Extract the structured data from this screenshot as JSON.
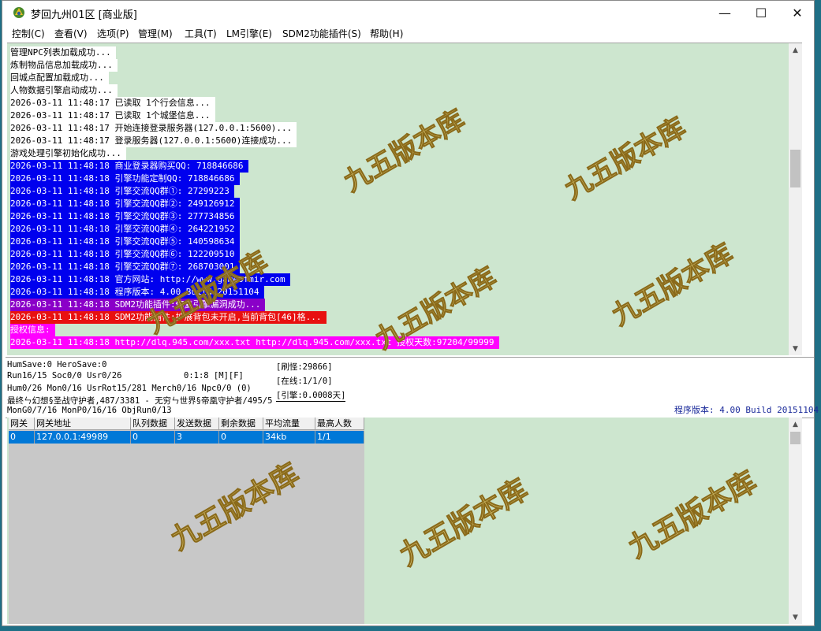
{
  "window": {
    "title": "梦回九州01区 [商业版]",
    "controls": {
      "minimize": "—",
      "maximize": "☐",
      "close": "✕"
    }
  },
  "menu": [
    {
      "label": "控制(C)"
    },
    {
      "label": "查看(V)"
    },
    {
      "label": "选项(P)"
    },
    {
      "label": "管理(M)"
    },
    {
      "label": "工具(T)"
    },
    {
      "label": "LM引擎(E)"
    },
    {
      "label": "SDM2功能插件(S)"
    },
    {
      "label": "帮助(H)"
    }
  ],
  "log": {
    "lines": [
      {
        "text": "管理NPC列表加载成功...",
        "bg": "#ffffff",
        "fg": "#000000"
      },
      {
        "text": "炼制物品信息加载成功...",
        "bg": "#ffffff",
        "fg": "#000000"
      },
      {
        "text": "回城点配置加载成功...",
        "bg": "#ffffff",
        "fg": "#000000"
      },
      {
        "text": "人物数据引擎启动成功...",
        "bg": "#ffffff",
        "fg": "#000000"
      },
      {
        "text": "2026-03-11 11:48:17 已读取 1个行会信息...",
        "bg": "#ffffff",
        "fg": "#000000"
      },
      {
        "text": "2026-03-11 11:48:17 已读取 1个城堡信息...",
        "bg": "#ffffff",
        "fg": "#000000"
      },
      {
        "text": "2026-03-11 11:48:17 开始连接登录服务器(127.0.0.1:5600)...",
        "bg": "#ffffff",
        "fg": "#000000"
      },
      {
        "text": "2026-03-11 11:48:17 登录服务器(127.0.0.1:5600)连接成功...",
        "bg": "#ffffff",
        "fg": "#000000"
      },
      {
        "text": "游戏处理引擎初始化成功...",
        "bg": "#ffffff",
        "fg": "#000000"
      },
      {
        "text": "2026-03-11 11:48:18 商业登录器购买QQ: 718846686",
        "bg": "#0000ee",
        "fg": "#ffffff"
      },
      {
        "text": "2026-03-11 11:48:18 引擎功能定制QQ: 718846686",
        "bg": "#0000ee",
        "fg": "#ffffff"
      },
      {
        "text": "2026-03-11 11:48:18 引擎交流QQ群①: 27299223",
        "bg": "#0000ee",
        "fg": "#ffffff"
      },
      {
        "text": "2026-03-11 11:48:18 引擎交流QQ群②: 249126912",
        "bg": "#0000ee",
        "fg": "#ffffff"
      },
      {
        "text": "2026-03-11 11:48:18 引擎交流QQ群③: 277734856",
        "bg": "#0000ee",
        "fg": "#ffffff"
      },
      {
        "text": "2026-03-11 11:48:18 引擎交流QQ群④: 264221952",
        "bg": "#0000ee",
        "fg": "#ffffff"
      },
      {
        "text": "2026-03-11 11:48:18 引擎交流QQ群⑤: 140598634",
        "bg": "#0000ee",
        "fg": "#ffffff"
      },
      {
        "text": "2026-03-11 11:48:18 引擎交流QQ群⑥: 122209510",
        "bg": "#0000ee",
        "fg": "#ffffff"
      },
      {
        "text": "2026-03-11 11:48:18 引擎交流QQ群⑦: 268703001",
        "bg": "#0000ee",
        "fg": "#ffffff"
      },
      {
        "text": "2026-03-11 11:48:18 官方网站: http://www.gameofmir.com",
        "bg": "#0000ee",
        "fg": "#ffffff"
      },
      {
        "text": "2026-03-11 11:48:18 程序版本: 4.00 Build 20151104",
        "bg": "#0000ee",
        "fg": "#ffffff"
      },
      {
        "text": "2026-03-11 11:48:18 SDM2功能插件:修复引擎漏洞成功...",
        "bg": "#8a00c8",
        "fg": "#ffffff"
      },
      {
        "text": "2026-03-11 11:48:18 SDM2功能插件:扩展背包未开启,当前背包[46]格...",
        "bg": "#e81010",
        "fg": "#ffffff"
      },
      {
        "text": "授权信息:",
        "bg": "#ff00ff",
        "fg": "#ffffff"
      },
      {
        "text": "2026-03-11 11:48:18 http://dlq.945.com/xxx.txt http://dlq.945.com/xxx.txt 授权天数:97204/99999",
        "bg": "#ff00ff",
        "fg": "#ffffff"
      }
    ]
  },
  "status": {
    "line1": "HumSave:0 HeroSave:0",
    "line2": "Run16/15 Soc0/0 Usr0/26",
    "line2b": "0:1:8 [M][F]",
    "line3": "Hum0/26 Mon0/16 UsrRot15/281 Merch0/16 Npc0/0 (0)",
    "line4": "最终ㄣ幻想§圣战守护者,487/3381 - 无穷ㄣ世界§帝凰守护者/495/5",
    "line5": "MonG0/7/16 MonP0/16/16 ObjRun0/13",
    "box1": "[刷怪:29866]",
    "box2": "[在线:1/1/0]",
    "box3": "[引擎:0.0008天]",
    "version": "程序版本: 4.00 Build 20151104"
  },
  "gateways": {
    "columns": [
      "网关",
      "网关地址",
      "队列数据",
      "发送数据",
      "剩余数据",
      "平均流量",
      "最高人数"
    ],
    "rows": [
      [
        "0",
        "127.0.0.1:49989",
        "0",
        "3",
        "0",
        "34kb",
        "1/1"
      ]
    ]
  },
  "colors": {
    "log_bg": "#cde6cf",
    "selection": "#0078d7"
  },
  "icons": {
    "app": "app-icon",
    "scroll_up": "scroll-up-icon",
    "scroll_down": "scroll-down-icon"
  }
}
